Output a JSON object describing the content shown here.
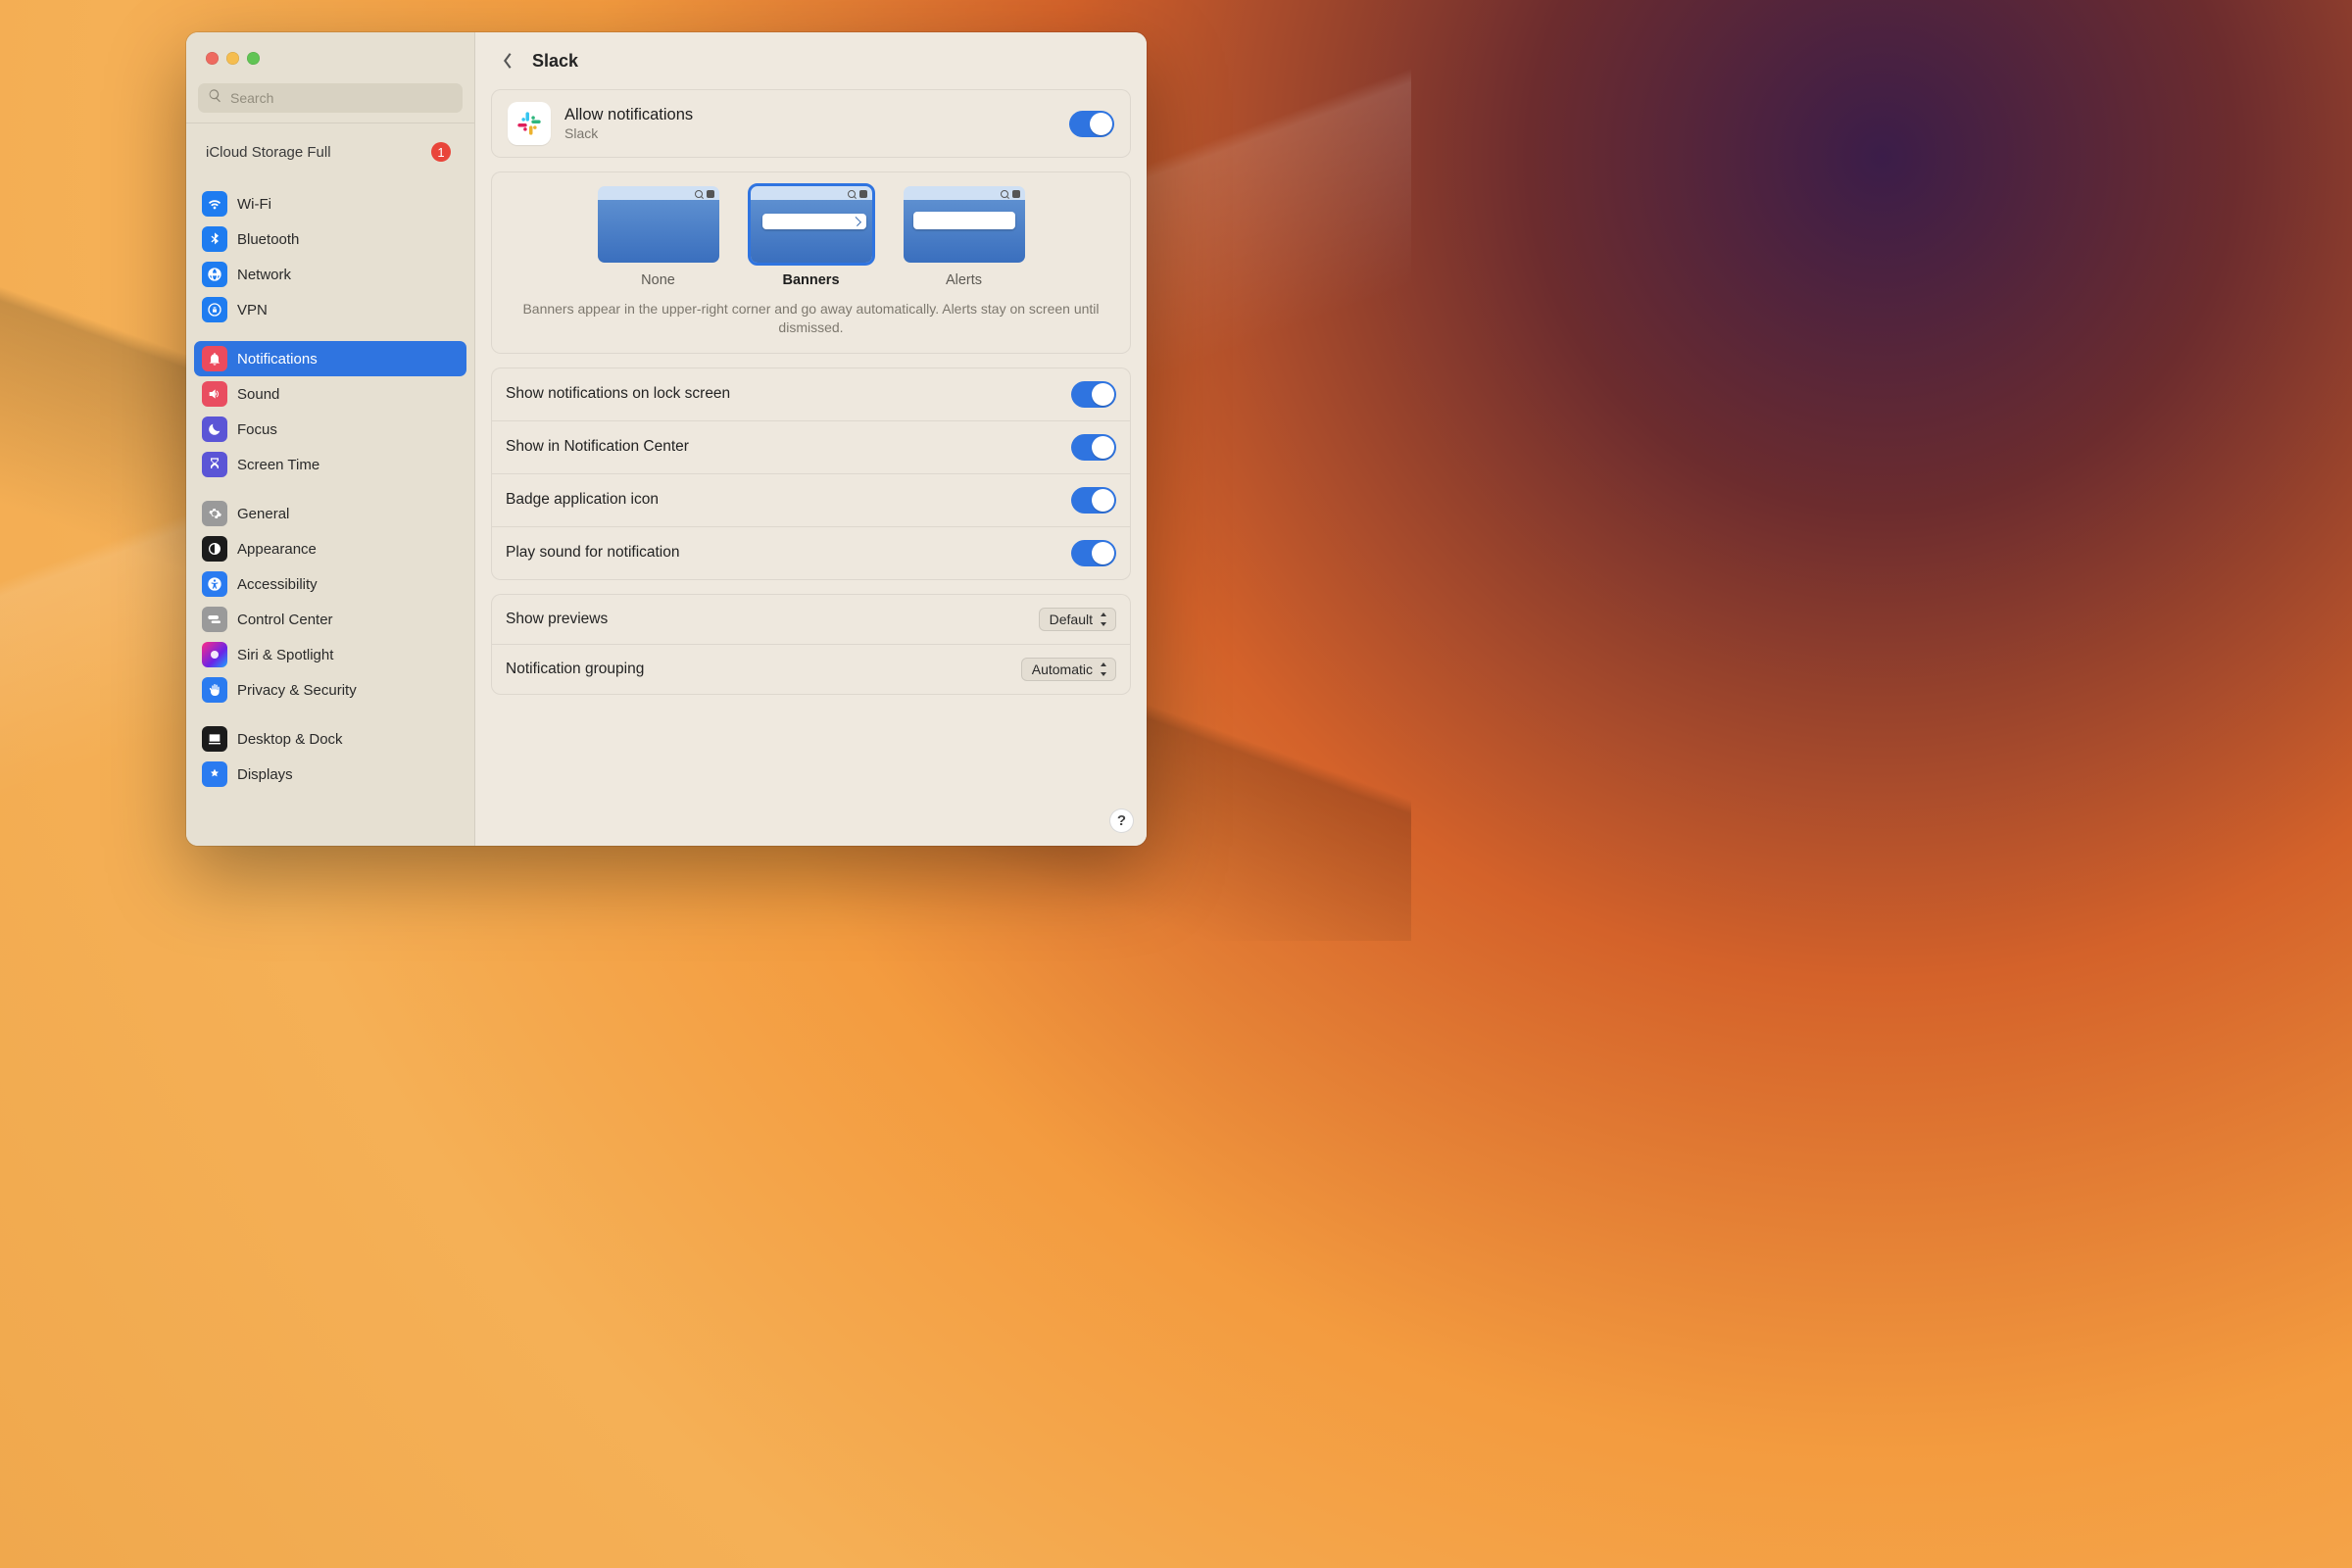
{
  "header": {
    "title": "Slack"
  },
  "search": {
    "placeholder": "Search"
  },
  "storage": {
    "label": "iCloud Storage Full",
    "badge": "1"
  },
  "sidebar": {
    "items": [
      {
        "label": "Wi-Fi"
      },
      {
        "label": "Bluetooth"
      },
      {
        "label": "Network"
      },
      {
        "label": "VPN"
      },
      {
        "label": "Notifications"
      },
      {
        "label": "Sound"
      },
      {
        "label": "Focus"
      },
      {
        "label": "Screen Time"
      },
      {
        "label": "General"
      },
      {
        "label": "Appearance"
      },
      {
        "label": "Accessibility"
      },
      {
        "label": "Control Center"
      },
      {
        "label": "Siri & Spotlight"
      },
      {
        "label": "Privacy & Security"
      },
      {
        "label": "Desktop & Dock"
      },
      {
        "label": "Displays"
      }
    ]
  },
  "allow": {
    "title": "Allow notifications",
    "subtitle": "Slack"
  },
  "styles": {
    "none": "None",
    "banners": "Banners",
    "alerts": "Alerts",
    "desc": "Banners appear in the upper-right corner and go away automatically. Alerts stay on screen until dismissed."
  },
  "settings": {
    "lock": "Show notifications on lock screen",
    "center": "Show in Notification Center",
    "badge": "Badge application icon",
    "sound": "Play sound for notification"
  },
  "selects": {
    "previews_label": "Show previews",
    "previews_value": "Default",
    "grouping_label": "Notification grouping",
    "grouping_value": "Automatic"
  },
  "help": "?"
}
